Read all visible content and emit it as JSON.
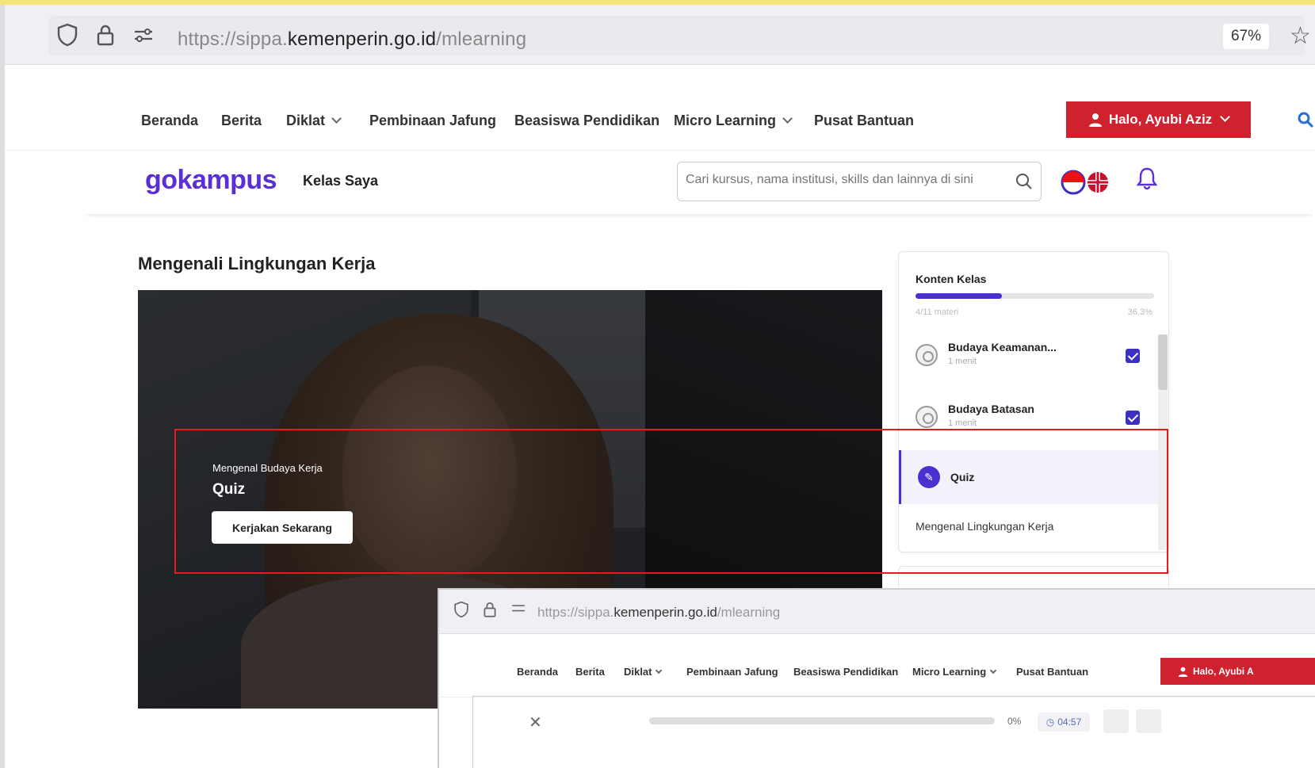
{
  "browser": {
    "url_prefix": "https://sippa.",
    "url_domain": "kemenperin.go.id",
    "url_path": "/mlearning",
    "zoom": "67%"
  },
  "nav": {
    "items": [
      {
        "label": "Beranda"
      },
      {
        "label": "Berita"
      },
      {
        "label": "Diklat"
      },
      {
        "label": "Pembinaan Jafung"
      },
      {
        "label": "Beasiswa Pendidikan"
      },
      {
        "label": "Micro Learning"
      },
      {
        "label": "Pusat Bantuan"
      }
    ],
    "user_label": "Halo, Ayubi Aziz"
  },
  "header": {
    "logo": "gokampus",
    "kelas_saya": "Kelas Saya",
    "search_placeholder": "Cari kursus, nama institusi, skills dan lainnya di sini"
  },
  "course": {
    "title": "Mengenali Lingkungan Kerja",
    "hero_subtitle": "Mengenal Budaya Kerja",
    "hero_title": "Quiz",
    "cta": "Kerjakan Sekarang"
  },
  "panel": {
    "heading": "Konten Kelas",
    "progress_fraction": 0.363,
    "progress_left": "4/11 materi",
    "progress_right": "36.3%",
    "lessons": [
      {
        "title": "Budaya Keamanan...",
        "duration": "1 menit",
        "done": true
      },
      {
        "title": "Budaya Batasan",
        "duration": "1 menit",
        "done": true
      }
    ],
    "active": {
      "title": "Quiz"
    },
    "section": "Mengenal Lingkungan Kerja"
  },
  "inset": {
    "url_prefix": "https://sippa.",
    "url_domain": "kemenperin.go.id",
    "url_path": "/mlearning",
    "nav": [
      "Beranda",
      "Berita",
      "Diklat",
      "Pembinaan Jafung",
      "Beasiswa Pendidikan",
      "Micro Learning",
      "Pusat Bantuan"
    ],
    "user_label": "Halo, Ayubi A",
    "progress_pct": "0%",
    "timer": "04:57"
  },
  "colors": {
    "brand": "#5b2fd6",
    "primary": "#4b2fd0",
    "user_button": "#d0212e",
    "highlight": "#e21b1b"
  }
}
